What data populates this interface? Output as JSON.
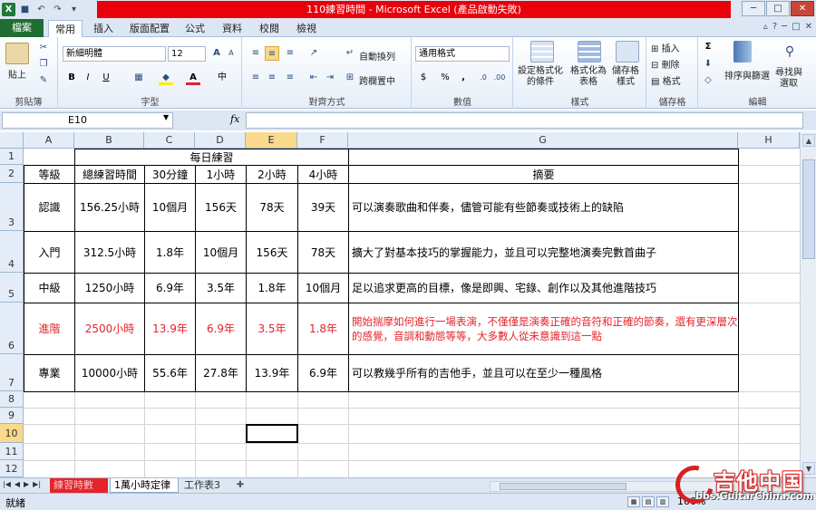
{
  "window": {
    "title": "110練習時間 - Microsoft Excel (產品啟動失敗)",
    "controls": {
      "minimize": "─",
      "maximize": "□",
      "close": "✕"
    }
  },
  "qat": {
    "excel_icon": "X",
    "save_icon": "■",
    "undo_icon": "↶",
    "redo_icon": "↷",
    "customize_icon": "▾"
  },
  "ribbon_tabs": [
    "檔案",
    "常用",
    "插入",
    "版面配置",
    "公式",
    "資料",
    "校閱",
    "檢視"
  ],
  "ribbon": {
    "clipboard": {
      "label": "剪貼簿",
      "paste": "貼上"
    },
    "font": {
      "label": "字型",
      "font_name": "新細明體",
      "font_size": "12",
      "bold": "B",
      "italic": "I",
      "underline": "U",
      "grow": "A",
      "shrink": "A",
      "phonetic": "中"
    },
    "alignment": {
      "label": "對齊方式",
      "wrap": "自動換列",
      "merge": "跨欄置中"
    },
    "number": {
      "label": "數值",
      "format": "通用格式",
      "currency": "$",
      "percent": "%",
      "comma": ","
    },
    "styles": {
      "label": "樣式",
      "conditional": [
        "設定格式化",
        "的條件"
      ],
      "as_table": [
        "格式化為",
        "表格"
      ],
      "cell_styles": [
        "儲存格",
        "樣式"
      ]
    },
    "cells": {
      "label": "儲存格",
      "insert": "插入",
      "delete": "刪除",
      "format": "格式"
    },
    "editing": {
      "label": "編輯",
      "sort": [
        "排序與篩選",
        ""
      ],
      "find": [
        "尋找與",
        "選取"
      ],
      "sum": "Σ"
    }
  },
  "formula_bar": {
    "name_box": "E10",
    "fx": "fx",
    "formula": ""
  },
  "columns": [
    "A",
    "B",
    "C",
    "D",
    "E",
    "F",
    "G",
    "H"
  ],
  "rows": [
    "1",
    "2",
    "3",
    "4",
    "5",
    "6",
    "7",
    "8",
    "9",
    "10",
    "11",
    "12"
  ],
  "table": {
    "title": "每日練習",
    "headers": [
      "等級",
      "總練習時間",
      "30分鐘",
      "1小時",
      "2小時",
      "4小時",
      "摘要"
    ],
    "body": [
      {
        "level": "認識",
        "total": "156.25小時",
        "m30": "10個月",
        "h1": "156天",
        "h2": "78天",
        "h4": "39天",
        "summary": "可以演奏歌曲和伴奏，儘管可能有些節奏或技術上的缺陷",
        "highlight": false
      },
      {
        "level": "入門",
        "total": "312.5小時",
        "m30": "1.8年",
        "h1": "10個月",
        "h2": "156天",
        "h4": "78天",
        "summary": "擴大了對基本技巧的掌握能力，並且可以完整地演奏完數首曲子",
        "highlight": false
      },
      {
        "level": "中級",
        "total": "1250小時",
        "m30": "6.9年",
        "h1": "3.5年",
        "h2": "1.8年",
        "h4": "10個月",
        "summary": "足以追求更高的目標，像是即興、宅錄、創作以及其他進階技巧",
        "highlight": false
      },
      {
        "level": "進階",
        "total": "2500小時",
        "m30": "13.9年",
        "h1": "6.9年",
        "h2": "3.5年",
        "h4": "1.8年",
        "summary": "開始揣摩如何進行一場表演，不僅僅是演奏正確的音符和正確的節奏，還有更深層次的感覺，音調和動態等等，大多數人從未意識到這一點",
        "highlight": true
      },
      {
        "level": "專業",
        "total": "10000小時",
        "m30": "55.6年",
        "h1": "27.8年",
        "h2": "13.9年",
        "h4": "6.9年",
        "summary": "可以教幾乎所有的吉他手，並且可以在至少一種風格",
        "highlight": false
      }
    ]
  },
  "sheet_tabs": [
    "練習時數",
    "1萬小時定律",
    "工作表3"
  ],
  "status": {
    "ready": "就緒",
    "zoom": "100%"
  },
  "watermark": {
    "brand": "吉他中国",
    "url": "bbs.GuitarChina.com"
  },
  "colors": {
    "title_red": "#e8000b",
    "accent_red": "#e5232a",
    "selection_header": "#f9d98b"
  }
}
